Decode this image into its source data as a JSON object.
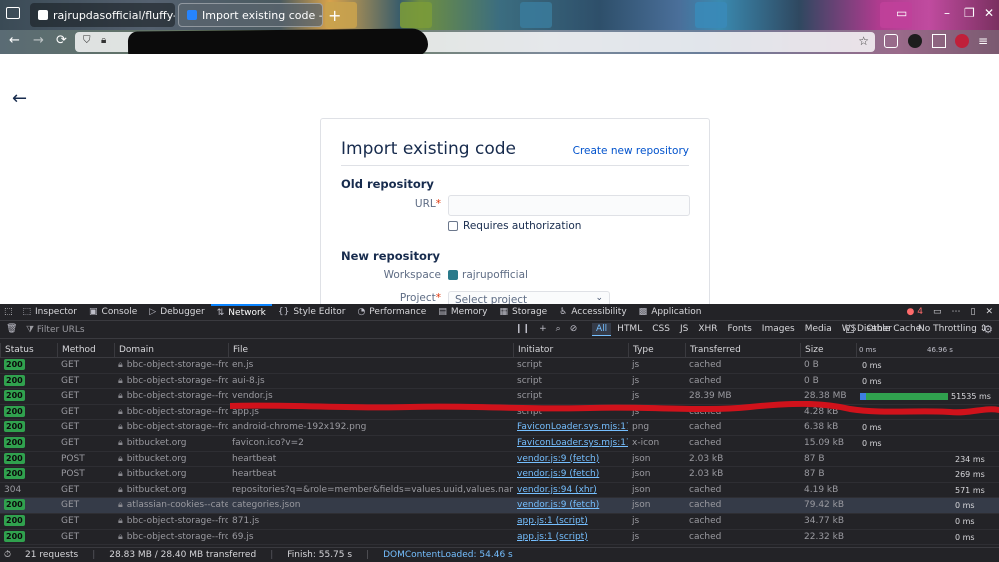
{
  "browser": {
    "tabs": [
      {
        "title": "rajrupdasofficial/fluffy-car",
        "active": false
      },
      {
        "title": "Import existing code — Bi",
        "active": true
      }
    ],
    "icons": {
      "back": "←",
      "forward": "→",
      "reload": "⟳",
      "new_tab": "+",
      "close": "×",
      "minimize": "–",
      "restore": "❐",
      "window_close": "✕",
      "bookmark": "☆"
    }
  },
  "page": {
    "back_icon": "←",
    "title": "Import existing code",
    "create_link": "Create new repository",
    "old_repo": {
      "heading": "Old repository",
      "url_label": "URL",
      "required_mark": "*",
      "requires_auth": "Requires authorization"
    },
    "new_repo": {
      "heading": "New repository",
      "workspace_label": "Workspace",
      "workspace_value": "rajrupofficial",
      "project_label": "Project",
      "project_placeholder": "Select project"
    }
  },
  "devtools": {
    "tabs": [
      {
        "icon": "⬚",
        "label": "Inspector"
      },
      {
        "icon": "▣",
        "label": "Console"
      },
      {
        "icon": "▷",
        "label": "Debugger"
      },
      {
        "icon": "⇅",
        "label": "Network",
        "active": true
      },
      {
        "icon": "{}",
        "label": "Style Editor"
      },
      {
        "icon": "◔",
        "label": "Performance"
      },
      {
        "icon": "▤",
        "label": "Memory"
      },
      {
        "icon": "▦",
        "label": "Storage"
      },
      {
        "icon": "♿",
        "label": "Accessibility"
      },
      {
        "icon": "▩",
        "label": "Application"
      }
    ],
    "error_count": "4",
    "filter_placeholder": "Filter URLs",
    "type_filters": [
      "All",
      "HTML",
      "CSS",
      "JS",
      "XHR",
      "Fonts",
      "Images",
      "Media",
      "WS",
      "Other"
    ],
    "disable_cache": "Disable Cache",
    "throttling": "No Throttling ⇕",
    "columns": [
      "Status",
      "Method",
      "Domain",
      "File",
      "Initiator",
      "Type",
      "Transferred",
      "Size"
    ],
    "timeline_ticks": [
      "0 ms",
      "46.96 s"
    ],
    "rows": [
      {
        "status": "200",
        "method": "GET",
        "domain": "bbc-object-storage--frontb...",
        "file": "en.js",
        "initiator": "script",
        "initiator_link": false,
        "type": "js",
        "transferred": "cached",
        "size": "0 B",
        "timing": "0 ms"
      },
      {
        "status": "200",
        "method": "GET",
        "domain": "bbc-object-storage--frontb...",
        "file": "aui-8.js",
        "initiator": "script",
        "initiator_link": false,
        "type": "js",
        "transferred": "cached",
        "size": "0 B",
        "timing": "0 ms"
      },
      {
        "status": "200",
        "method": "GET",
        "domain": "bbc-object-storage--frontb...",
        "file": "vendor.js",
        "initiator": "script",
        "initiator_link": false,
        "type": "js",
        "transferred": "28.39 MB",
        "size": "28.38 MB",
        "timing": "51535 ms",
        "bar": true
      },
      {
        "status": "200",
        "method": "GET",
        "domain": "bbc-object-storage--frontb...",
        "file": "app.js",
        "initiator": "script",
        "initiator_link": false,
        "type": "js",
        "transferred": "cached",
        "size": "4.28 kB",
        "timing": ""
      },
      {
        "status": "200",
        "method": "GET",
        "domain": "bbc-object-storage--frontb...",
        "file": "android-chrome-192x192.png",
        "initiator": "FaviconLoader.sys.mjs:175 (img)",
        "initiator_link": true,
        "type": "png",
        "transferred": "cached",
        "size": "6.38 kB",
        "timing": "0 ms"
      },
      {
        "status": "200",
        "method": "GET",
        "domain": "bitbucket.org",
        "file": "favicon.ico?v=2",
        "initiator": "FaviconLoader.sys.mjs:175 (img)",
        "initiator_link": true,
        "type": "x-icon",
        "transferred": "cached",
        "size": "15.09 kB",
        "timing": "0 ms"
      },
      {
        "status": "200",
        "method": "POST",
        "domain": "bitbucket.org",
        "file": "heartbeat",
        "initiator": "vendor.js:9 (fetch)",
        "initiator_link": true,
        "type": "json",
        "transferred": "2.03 kB",
        "size": "87 B",
        "timing": "234 ms"
      },
      {
        "status": "200",
        "method": "POST",
        "domain": "bitbucket.org",
        "file": "heartbeat",
        "initiator": "vendor.js:9 (fetch)",
        "initiator_link": true,
        "type": "json",
        "transferred": "2.03 kB",
        "size": "87 B",
        "timing": "269 ms"
      },
      {
        "status": "304",
        "method": "GET",
        "domain": "bitbucket.org",
        "file": "repositories?q=&role=member&fields=values.uuid,values.name,values.workspace",
        "initiator": "vendor.js:94 (xhr)",
        "initiator_link": true,
        "type": "json",
        "transferred": "cached",
        "size": "4.19 kB",
        "timing": "571 ms"
      },
      {
        "status": "200",
        "method": "GET",
        "domain": "atlassian-cookies--categori...",
        "file": "categories.json",
        "initiator": "vendor.js:9 (fetch)",
        "initiator_link": true,
        "type": "json",
        "transferred": "cached",
        "size": "79.42 kB",
        "timing": "0 ms",
        "selected": true
      },
      {
        "status": "200",
        "method": "GET",
        "domain": "bbc-object-storage--frontb...",
        "file": "871.js",
        "initiator": "app.js:1 (script)",
        "initiator_link": true,
        "type": "js",
        "transferred": "cached",
        "size": "34.77 kB",
        "timing": "0 ms"
      },
      {
        "status": "200",
        "method": "GET",
        "domain": "bbc-object-storage--frontb...",
        "file": "69.js",
        "initiator": "app.js:1 (script)",
        "initiator_link": true,
        "type": "js",
        "transferred": "cached",
        "size": "22.32 kB",
        "timing": "0 ms"
      }
    ],
    "status_bar": {
      "requests": "21 requests",
      "transferred": "28.83 MB / 28.40 MB transferred",
      "finish": "Finish: 55.75 s",
      "dom_loaded": "DOMContentLoaded: 54.46 s"
    }
  },
  "colors": {
    "accent": "#0a84ff",
    "link": "#0052cc",
    "status_ok": "#30a14e",
    "redact_line": "#d0121b"
  }
}
